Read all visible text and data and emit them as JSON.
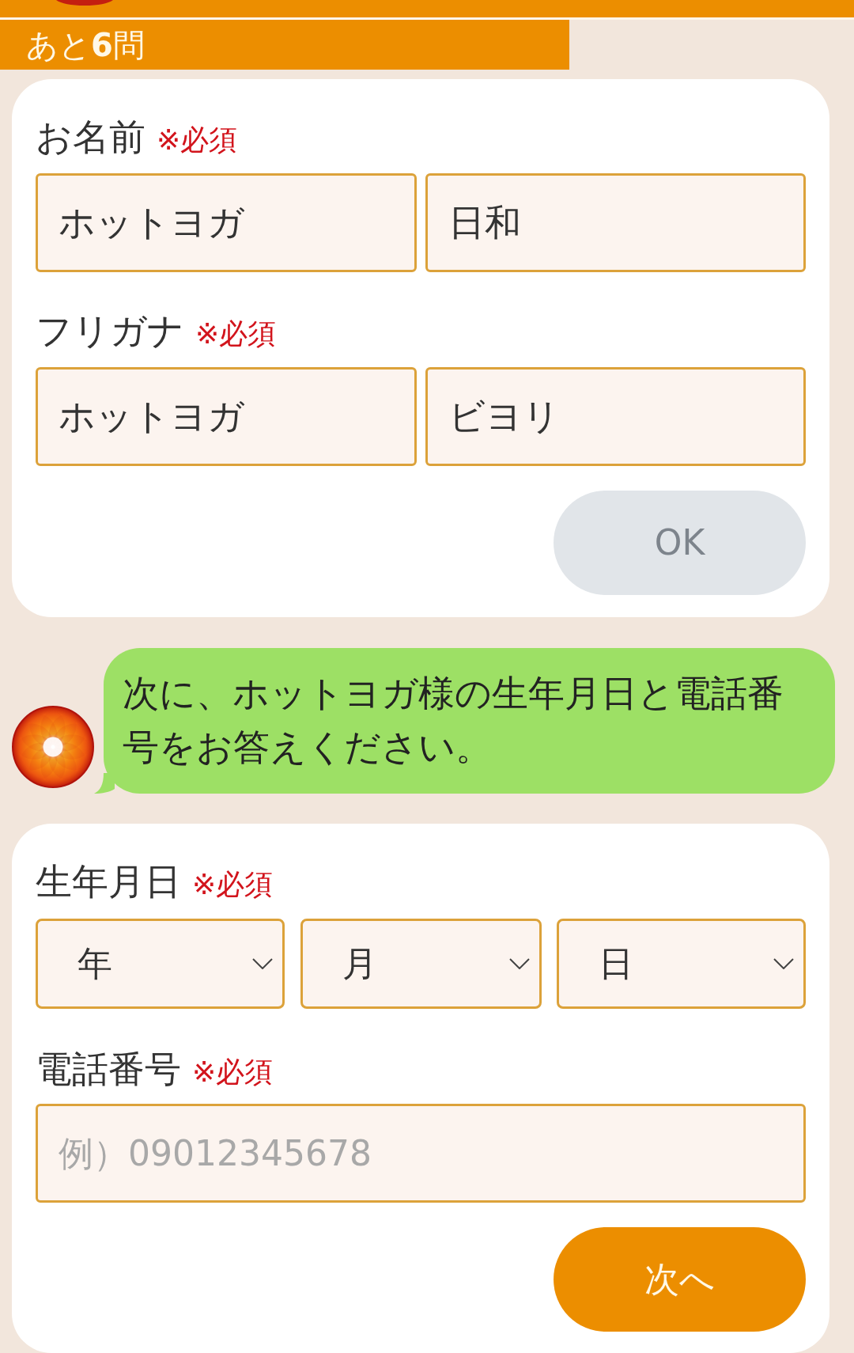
{
  "progress": {
    "remaining": "あと**6**問"
  },
  "name_card": {
    "fields": [
      {
        "label": "お名前",
        "required": "※必須",
        "inputs": [
          {
            "value": "ホットヨガ"
          },
          {
            "value": "日和"
          }
        ]
      },
      {
        "label": "フリガナ",
        "required": "※必須",
        "inputs": [
          {
            "value": "ホットヨガ"
          },
          {
            "value": "ビヨリ"
          }
        ]
      }
    ],
    "button": {
      "label": "OK",
      "disabled": true
    }
  },
  "chat": {
    "message": "次に、ホットヨガ様の生年月日と電話番号をお答えください。"
  },
  "contact_card": {
    "birthdate": {
      "label": "生年月日",
      "required": "※必須",
      "selects": [
        {
          "value": "年"
        },
        {
          "value": "月"
        },
        {
          "value": "日"
        }
      ]
    },
    "phone": {
      "label": "電話番号",
      "required": "※必須",
      "placeholder": "例）09012345678"
    },
    "button": {
      "label": "次へ",
      "disabled": false
    }
  }
}
